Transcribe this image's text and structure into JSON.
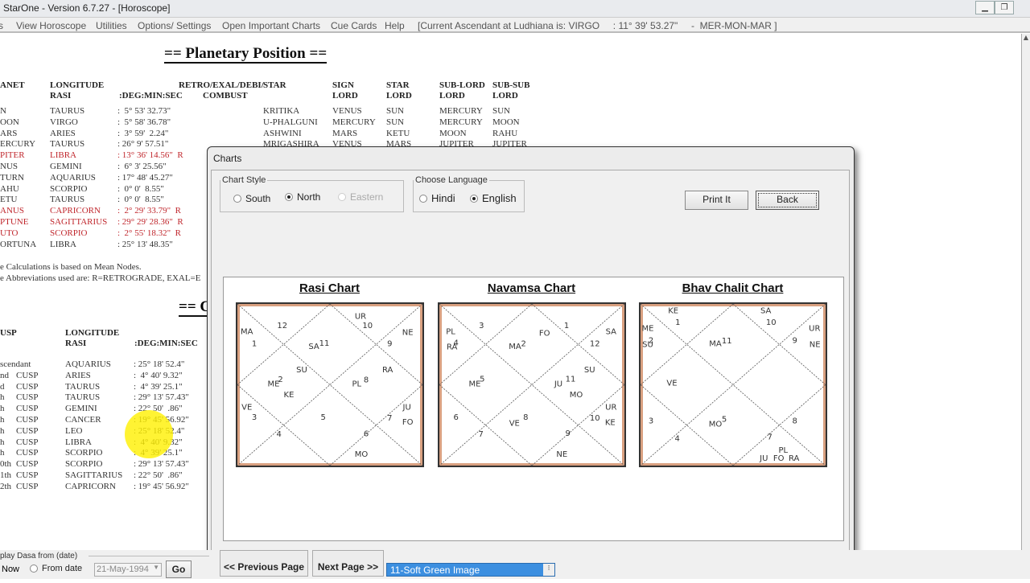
{
  "window": {
    "title": "StarOne - Version 6.7.27 - [Horoscope]",
    "controls": [
      "minimize",
      "restore"
    ]
  },
  "menu": {
    "items": [
      "s",
      "View Horoscope",
      "Utilities",
      "Options/ Settings",
      "Open Important Charts",
      "Cue Cards",
      "Help"
    ],
    "status": "[Current Ascendant at Ludhiana is: VIRGO     : 11° 39' 53.27\"     -  MER-MON-MAR ]"
  },
  "planetary": {
    "title": "== Planetary Position ==",
    "headers": {
      "planet": "ANET",
      "longitude": "LONGITUDE",
      "rasi": "RASI",
      "deg": ":DEG:MIN:SEC",
      "retro": "RETRO/EXAL/DEBI/",
      "combust": "COMBUST",
      "star": "STAR",
      "sign1": "SIGN",
      "sign2": "LORD",
      "starlord1": "STAR",
      "starlord2": "LORD",
      "sub1": "SUB-LORD",
      "sub2": "LORD",
      "subsub1": "SUB-SUB",
      "subsub2": "LORD"
    },
    "rows": [
      {
        "planet": "N",
        "rasi": "TAURUS",
        "deg": ":  5° 53' 32.73\"",
        "star": "KRITIKA",
        "sign_lord": "VENUS",
        "star_lord": "SUN",
        "sub_lord": "MERCURY",
        "sub_sub": "SUN",
        "retro": false
      },
      {
        "planet": "OON",
        "rasi": "VIRGO",
        "deg": ":  5° 58' 36.78\"",
        "star": "U-PHALGUNI",
        "sign_lord": "MERCURY",
        "star_lord": "SUN",
        "sub_lord": "MERCURY",
        "sub_sub": "MOON",
        "retro": false
      },
      {
        "planet": "ARS",
        "rasi": "ARIES",
        "deg": ":  3° 59'  2.24\"",
        "star": "ASHWINI",
        "sign_lord": "MARS",
        "star_lord": "KETU",
        "sub_lord": "MOON",
        "sub_sub": "RAHU",
        "retro": false
      },
      {
        "planet": "ERCURY",
        "rasi": "TAURUS",
        "deg": ": 26° 9' 57.51\"",
        "star": "MRIGASHIRA",
        "sign_lord": "VENUS",
        "star_lord": "MARS",
        "sub_lord": "JUPITER",
        "sub_sub": "JUPITER",
        "retro": false
      },
      {
        "planet": "PITER",
        "rasi": "LIBRA",
        "deg": ": 13° 36' 14.56\"  R",
        "retro": true
      },
      {
        "planet": "NUS",
        "rasi": "GEMINI",
        "deg": ":  6° 3' 25.56\"",
        "retro": false
      },
      {
        "planet": "TURN",
        "rasi": "AQUARIUS",
        "deg": ": 17° 48' 45.27\"",
        "retro": false
      },
      {
        "planet": "AHU",
        "rasi": "SCORPIO",
        "deg": ":  0° 0'  8.55\"",
        "retro": false
      },
      {
        "planet": "ETU",
        "rasi": "TAURUS",
        "deg": ":  0° 0'  8.55\"",
        "retro": false
      },
      {
        "planet": "ANUS",
        "rasi": "CAPRICORN",
        "deg": ":  2° 29' 33.79\"  R",
        "retro": true
      },
      {
        "planet": "PTUNE",
        "rasi": "SAGITTARIUS",
        "deg": ": 29° 29' 28.36\"  R",
        "retro": true
      },
      {
        "planet": "UTO",
        "rasi": "SCORPIO",
        "deg": ":  2° 55' 18.32\"  R",
        "retro": true
      },
      {
        "planet": "ORTUNA",
        "rasi": "LIBRA",
        "deg": ": 25° 13' 48.35\"",
        "retro": false
      }
    ],
    "notes": [
      "e Calculations is based  on  Mean Nodes.",
      "e Abbreviations used are:  R=RETROGRADE,  EXAL=E"
    ],
    "retro_color": "#c0272d"
  },
  "cusps": {
    "title": "== C",
    "headers": {
      "cusp": "USP",
      "longitude": "LONGITUDE",
      "rasi": "RASI",
      "deg": ":DEG:MIN:SEC"
    },
    "rows": [
      {
        "n": "scendant",
        "c": "",
        "rasi": "AQUARIUS",
        "deg": ": 25° 18' 52.4\""
      },
      {
        "n": "nd",
        "c": "CUSP",
        "rasi": "ARIES",
        "deg": ":  4° 40' 9.32\""
      },
      {
        "n": "d",
        "c": "CUSP",
        "rasi": "TAURUS",
        "deg": ":  4° 39' 25.1\""
      },
      {
        "n": "h",
        "c": "CUSP",
        "rasi": "TAURUS",
        "deg": ": 29° 13' 57.43\""
      },
      {
        "n": "h",
        "c": "CUSP",
        "rasi": "GEMINI",
        "deg": ": 22° 50'  .86\""
      },
      {
        "n": "h",
        "c": "CUSP",
        "rasi": "CANCER",
        "deg": ": 19° 45' 56.92\""
      },
      {
        "n": "h",
        "c": "CUSP",
        "rasi": "LEO",
        "deg": ": 25° 18' 52.4\""
      },
      {
        "n": "h",
        "c": "CUSP",
        "rasi": "LIBRA",
        "deg": ":  4° 40' 9.32\""
      },
      {
        "n": "h",
        "c": "CUSP",
        "rasi": "SCORPIO",
        "deg": ":  4° 39' 25.1\""
      },
      {
        "n": "0th",
        "c": "CUSP",
        "rasi": "SCORPIO",
        "deg": ": 29° 13' 57.43\""
      },
      {
        "n": "1th",
        "c": "CUSP",
        "rasi": "SAGITTARIUS",
        "deg": ": 22° 50'  .86\""
      },
      {
        "n": "2th",
        "c": "CUSP",
        "rasi": "CAPRICORN",
        "deg": ": 19° 45' 56.92\""
      }
    ]
  },
  "dialog": {
    "title": "Charts",
    "chart_style": {
      "label": "Chart Style",
      "options": [
        "South",
        "North",
        "Eastern"
      ],
      "selected": "North",
      "disabled": [
        "Eastern"
      ]
    },
    "language": {
      "label": "Choose Language",
      "options": [
        "Hindi",
        "English"
      ],
      "selected": "English"
    },
    "print_label": "Print It",
    "back_label": "Back",
    "charts": [
      {
        "title": "Rasi Chart",
        "labels": [
          "MA",
          "1",
          "12",
          "SA",
          "11",
          "UR",
          "10",
          "NE",
          "9",
          "SU",
          "RA",
          "ME",
          "2",
          "PL",
          "8",
          "KE",
          "VE",
          "3",
          "5",
          "JU",
          "FO",
          "7",
          "4",
          "6",
          "MO"
        ]
      },
      {
        "title": "Navamsa Chart",
        "labels": [
          "PL",
          "RA",
          "4",
          "3",
          "FO",
          "1",
          "MA",
          "2",
          "SA",
          "12",
          "SU",
          "ME",
          "5",
          "JU",
          "11",
          "MO",
          "6",
          "VE",
          "8",
          "UR",
          "KE",
          "10",
          "7",
          "9",
          "NE"
        ]
      },
      {
        "title": "Bhav Chalit Chart",
        "labels": [
          "KE",
          "1",
          "SA",
          "10",
          "ME",
          "SU",
          "2",
          "MA",
          "11",
          "9",
          "UR",
          "NE",
          "VE",
          "3",
          "MO",
          "5",
          "8",
          "4",
          "7",
          "PL",
          "JU",
          "FO",
          "RA"
        ]
      }
    ]
  },
  "bottom": {
    "dasa_label": "play Dasa from (date)",
    "now_label": "Now",
    "from_date_label": "From date",
    "date_value": "21-May-1994",
    "go_label": "Go",
    "prev_label": "<< Previous Page",
    "next_label": "Next Page >>",
    "skin_value": "11-Soft Green Image",
    "skin_color": "#3c8fe0"
  }
}
